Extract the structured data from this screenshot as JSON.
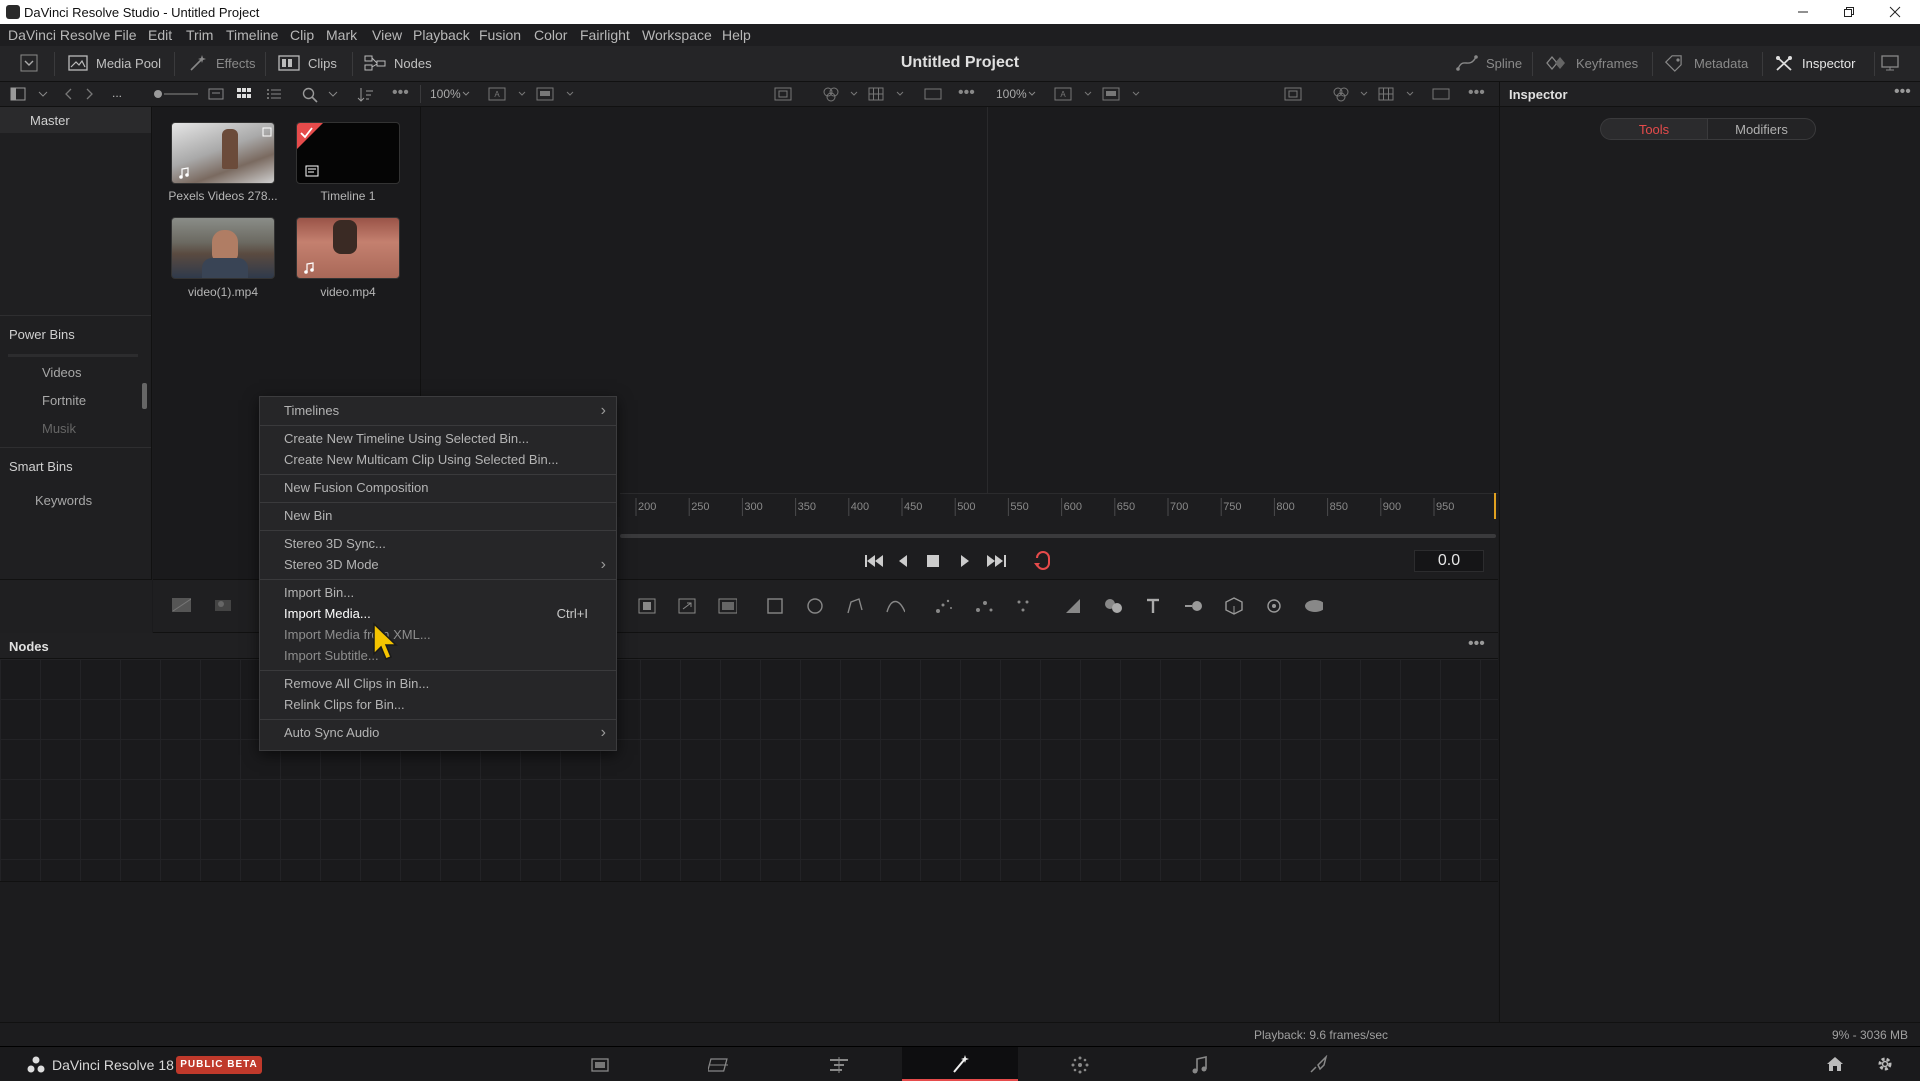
{
  "window": {
    "title": "DaVinci Resolve Studio - Untitled Project"
  },
  "menu": [
    "DaVinci Resolve",
    "File",
    "Edit",
    "Trim",
    "Timeline",
    "Clip",
    "Mark",
    "View",
    "Playback",
    "Fusion",
    "Color",
    "Fairlight",
    "Workspace",
    "Help"
  ],
  "toolbar": {
    "media_pool": "Media Pool",
    "effects": "Effects",
    "clips": "Clips",
    "nodes": "Nodes",
    "project_title": "Untitled Project",
    "spline": "Spline",
    "keyframes": "Keyframes",
    "metadata": "Metadata",
    "inspector": "Inspector"
  },
  "toolbar2": {
    "ellipsis": "...",
    "zoom_left": "100%",
    "zoom_right": "100%"
  },
  "sidebar": {
    "master": "Master",
    "power_bins": "Power Bins",
    "power_items": [
      "Videos",
      "Fortnite",
      "Musik"
    ],
    "smart_bins": "Smart Bins",
    "smart_items": [
      "Keywords"
    ]
  },
  "media": [
    {
      "label": "Pexels Videos 278...",
      "kind": "video-audio"
    },
    {
      "label": "Timeline 1",
      "kind": "timeline"
    },
    {
      "label": "video(1).mp4",
      "kind": "video"
    },
    {
      "label": "video.mp4",
      "kind": "video-audio"
    }
  ],
  "ruler_ticks": [
    "200",
    "250",
    "300",
    "350",
    "400",
    "450",
    "500",
    "550",
    "600",
    "650",
    "700",
    "750",
    "800",
    "850",
    "900",
    "950"
  ],
  "transport": {
    "timecode": "0.0"
  },
  "inspector": {
    "title": "Inspector",
    "tab_tools": "Tools",
    "tab_modifiers": "Modifiers"
  },
  "nodes_panel": {
    "title": "Nodes"
  },
  "context_menu": {
    "items": [
      {
        "label": "Timelines",
        "submenu": true
      },
      {
        "label": "Create New Timeline Using Selected Bin..."
      },
      {
        "label": "Create New Multicam Clip Using Selected Bin..."
      },
      {
        "label": "New Fusion Composition"
      },
      {
        "label": "New Bin"
      },
      {
        "label": "Stereo 3D Sync..."
      },
      {
        "label": "Stereo 3D Mode",
        "submenu": true
      },
      {
        "label": "Import Bin..."
      },
      {
        "label": "Import Media...",
        "shortcut": "Ctrl+I"
      },
      {
        "label": "Import Media from XML..."
      },
      {
        "label": "Import Subtitle..."
      },
      {
        "label": "Remove All Clips in Bin..."
      },
      {
        "label": "Relink Clips for Bin..."
      },
      {
        "label": "Auto Sync Audio",
        "submenu": true
      }
    ]
  },
  "status": {
    "playback": "Playback: 9.6 frames/sec",
    "memory": "9% - 3036 MB"
  },
  "bottom_bar": {
    "app_name": "DaVinci Resolve 18",
    "badge": "PUBLIC BETA"
  },
  "colors": {
    "accent_red": "#e64b4b",
    "badge_red": "#c0392b",
    "cursor_yellow": "#f5c400"
  }
}
